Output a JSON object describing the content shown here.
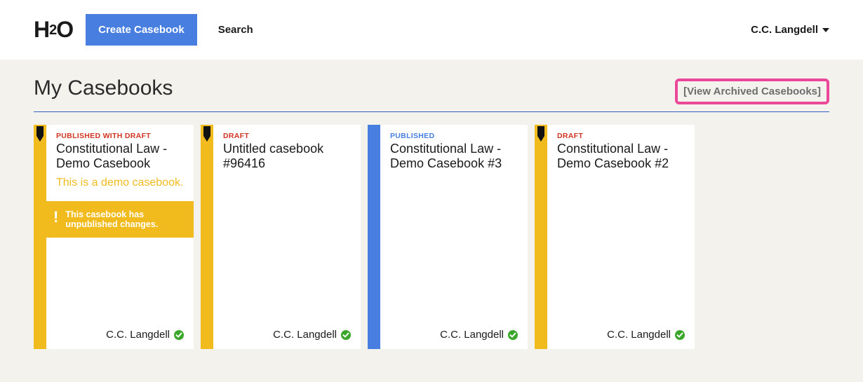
{
  "header": {
    "logo": "H2O",
    "create_button": "Create Casebook",
    "search_label": "Search",
    "user_name": "C.C. Langdell"
  },
  "main": {
    "heading": "My Casebooks",
    "archive_link": "[View Archived Casebooks]"
  },
  "cards": [
    {
      "status": "PUBLISHED WITH DRAFT",
      "status_class": "red",
      "strip": "yellow",
      "pencil": true,
      "title": "Constitutional Law - Demo Casebook",
      "description": "This is a demo casebook.",
      "alert": "This casebook has unpublished changes.",
      "author": "C.C. Langdell"
    },
    {
      "status": "DRAFT",
      "status_class": "red",
      "strip": "yellow",
      "pencil": true,
      "title": "Untitled casebook #96416",
      "description": "",
      "alert": "",
      "author": "C.C. Langdell"
    },
    {
      "status": "PUBLISHED",
      "status_class": "blue",
      "strip": "blue",
      "pencil": false,
      "title": "Constitutional Law - Demo Casebook #3",
      "description": "",
      "alert": "",
      "author": "C.C. Langdell"
    },
    {
      "status": "DRAFT",
      "status_class": "red",
      "strip": "yellow",
      "pencil": true,
      "title": "Constitutional Law - Demo Casebook #2",
      "description": "",
      "alert": "",
      "author": "C.C. Langdell"
    }
  ]
}
